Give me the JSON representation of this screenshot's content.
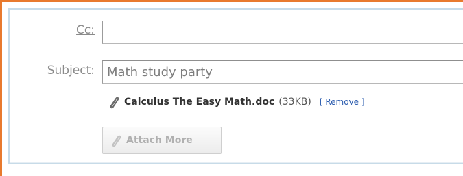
{
  "fields": {
    "cc_label": "Cc:",
    "cc_value": "",
    "subject_label": "Subject:",
    "subject_value": "Math study party"
  },
  "attachment": {
    "icon": "paperclip-icon",
    "filename": "Calculus The Easy Math.doc",
    "size": "(33KB)",
    "remove_label": "[ Remove ]"
  },
  "attach_more": {
    "icon": "paperclip-icon",
    "label": "Attach More"
  },
  "colors": {
    "frame_border": "#e87a2e",
    "panel_border": "#c7dbe8",
    "link": "#2f5fb0"
  }
}
